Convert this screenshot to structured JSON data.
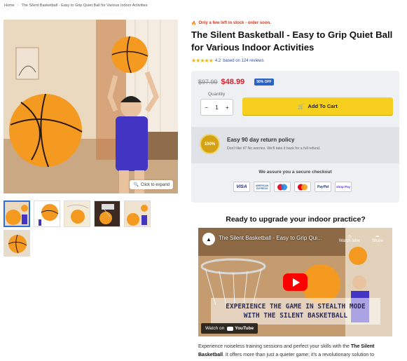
{
  "breadcrumb": {
    "home": "Home",
    "separator": "›",
    "current": "The Silent Basketball - Easy to Grip Quiet Ball for Various Indoor Activities"
  },
  "gallery": {
    "zoom_label": "Click to expand",
    "thumbnails": [
      "thumb-1",
      "thumb-2",
      "thumb-3",
      "thumb-4",
      "thumb-5",
      "thumb-6"
    ]
  },
  "product": {
    "stock_notice": "Only a few left in stock - order soon.",
    "title": "The Silent Basketball - Easy to Grip Quiet Ball for Various Indoor Activities",
    "stars": "★★★★★",
    "rating_value": "4.2",
    "rating_text": "based on 124 reviews",
    "old_price": "$97.99",
    "price": "$48.99",
    "discount_badge": "50% OFF",
    "quantity_label": "Quantity",
    "quantity_minus": "−",
    "quantity_value": "1",
    "quantity_plus": "+",
    "add_to_cart": "Add To Cart"
  },
  "return_policy": {
    "seal": "100%",
    "title": "Easy 90 day return policy",
    "subtitle": "Don't like it? No worries. We'll take it back for a full refund."
  },
  "secure_checkout": {
    "title": "We assure you a secure checkout",
    "cards": [
      "VISA",
      "AMERICAN EXPRESS",
      "",
      "",
      "PayPal",
      "shop Pay"
    ]
  },
  "video_section": {
    "heading": "Ready to upgrade your indoor practice?",
    "video_title": "The Silent Basketball - Easy to Grip Qui...",
    "watch_later": "Watch later",
    "share": "Share",
    "banner_line1": "EXPERIENCE THE GAME IN STEALTH MODE",
    "banner_line2": "WITH THE SILENT BASKETBALL",
    "watch_on": "Watch on",
    "youtube": "YouTube"
  },
  "description": {
    "part1": "Experience noiseless training sessions and perfect your skills with the ",
    "bold": "The Silent Basketball",
    "part2": ". It offers more than just a quieter game; it's a revolutionary solution to"
  },
  "colors": {
    "accent_red": "#d61f2b",
    "cart_yellow": "#f7cf1e",
    "badge_blue": "#2962c6"
  }
}
